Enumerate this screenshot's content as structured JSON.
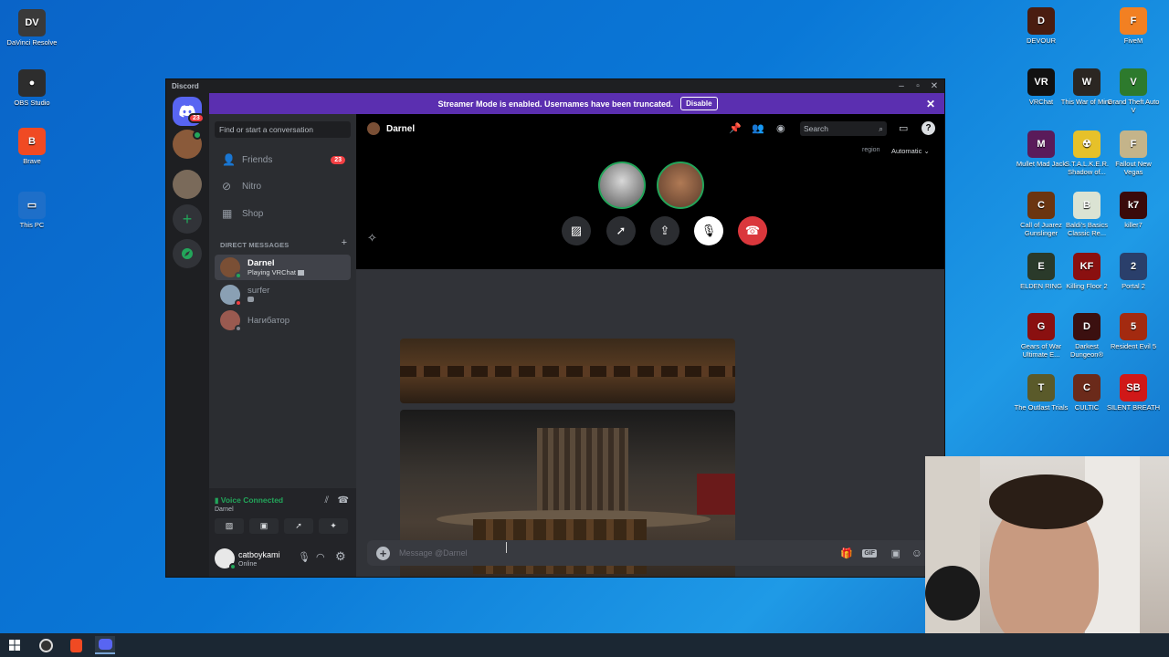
{
  "desktop_left": [
    {
      "label": "DaVinci Resolve",
      "color": "#3a3a3a",
      "glyph": "DV"
    },
    {
      "label": "OBS Studio",
      "color": "#2d2d2d",
      "glyph": "●"
    },
    {
      "label": "Brave",
      "color": "#f04a23",
      "glyph": "B"
    },
    {
      "label": "This PC",
      "color": "#1e6fc9",
      "glyph": "▭"
    }
  ],
  "desktop_right": [
    {
      "label": "DEVOUR",
      "color": "#4a1d10",
      "glyph": "D"
    },
    {
      "label": "FiveM",
      "color": "#f28022",
      "glyph": "F"
    },
    {
      "label": "VRChat",
      "color": "#111",
      "glyph": "VR"
    },
    {
      "label": "This War of Mine",
      "color": "#2b2622",
      "glyph": "W"
    },
    {
      "label": "Grand Theft Auto V",
      "color": "#2d7a2d",
      "glyph": "V"
    },
    {
      "label": "Mullet Mad Jack",
      "color": "#5a1b5a",
      "glyph": "M"
    },
    {
      "label": "S.T.A.L.K.E.R. Shadow of...",
      "color": "#e6c12a",
      "glyph": "☢"
    },
    {
      "label": "Fallout New Vegas",
      "color": "#c4b48a",
      "glyph": "F"
    },
    {
      "label": "Call of Juarez Gunslinger",
      "color": "#6b3510",
      "glyph": "C"
    },
    {
      "label": "Baldi's Basics Classic Re...",
      "color": "#dbe3d3",
      "glyph": "B"
    },
    {
      "label": "killer7",
      "color": "#3a0a0a",
      "glyph": "k7"
    },
    {
      "label": "ELDEN RING",
      "color": "#2a3a2a",
      "glyph": "E"
    },
    {
      "label": "Killing Floor 2",
      "color": "#8a1010",
      "glyph": "KF"
    },
    {
      "label": "Portal 2",
      "color": "#2a3f6b",
      "glyph": "2"
    },
    {
      "label": "Gears of War Ultimate E...",
      "color": "#8a1010",
      "glyph": "G"
    },
    {
      "label": "Darkest Dungeon®",
      "color": "#3b1010",
      "glyph": "D"
    },
    {
      "label": "Resident Evil 5",
      "color": "#a32a10",
      "glyph": "5"
    },
    {
      "label": "The Outlast Trials",
      "color": "#5a5a2a",
      "glyph": "T"
    },
    {
      "label": "CULTIC",
      "color": "#6b2a1a",
      "glyph": "C"
    },
    {
      "label": "SILENT BREATH",
      "color": "#d01818",
      "glyph": "SB"
    }
  ],
  "window": {
    "title": "Discord"
  },
  "banner": {
    "text": "Streamer Mode is enabled. Usernames have been truncated.",
    "button": "Disable"
  },
  "guild_badge": "23",
  "sidebar": {
    "search_placeholder": "Find or start a conversation",
    "nav": [
      {
        "label": "Friends",
        "icon": "friends-icon",
        "badge": "23"
      },
      {
        "label": "Nitro",
        "icon": "nitro-icon"
      },
      {
        "label": "Shop",
        "icon": "shop-icon"
      }
    ],
    "dm_header": "DIRECT MESSAGES",
    "dms": [
      {
        "name": "Darnel",
        "sub": "Playing VRChat",
        "color": "#7a4f35",
        "active": true
      },
      {
        "name": "surfer",
        "sub": "",
        "color": "#8aa0b4"
      },
      {
        "name": "Нагибатор",
        "sub": "",
        "color": "#9a5a50"
      }
    ]
  },
  "voice": {
    "status": "Voice Connected",
    "channel": "Darnel"
  },
  "user": {
    "name": "catboykami",
    "status": "Online"
  },
  "header": {
    "name": "Darnel",
    "search": "Search",
    "region_label": "region",
    "region_value": "Automatic"
  },
  "composer": {
    "placeholder": "Message @Darnel"
  },
  "colors": {
    "blurple": "#5865f2",
    "green": "#23a55a",
    "red": "#da373c",
    "banner": "#5b2fb0"
  }
}
